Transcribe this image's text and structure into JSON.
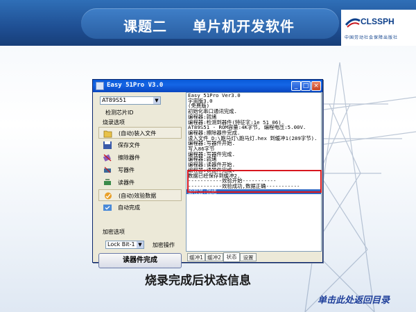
{
  "slide": {
    "title_part1": "课题二",
    "title_part2": "单片机开发软件",
    "logo_text": "CLSSPH",
    "logo_subtext": "中国劳动社会保障出版社",
    "caption": "烧录完成后状态信息",
    "back_link": "单击此处返回目录"
  },
  "window": {
    "title": "Easy 51Pro V3.0",
    "chip_value": "AT89S51",
    "detect_label": "检测芯片ID",
    "burn_options_label": "烧录选项",
    "menu": [
      {
        "label": "(自动)装入文件",
        "icon": "folder-open-icon"
      },
      {
        "label": "保存文件",
        "icon": "save-disk-icon"
      },
      {
        "label": "擦除器件",
        "icon": "erase-icon"
      },
      {
        "label": "写器件",
        "icon": "write-chip-icon"
      },
      {
        "label": "读器件",
        "icon": "read-chip-icon"
      },
      {
        "label": "(自动)效验数据",
        "icon": "verify-icon"
      },
      {
        "label": "自动完成",
        "icon": "auto-complete-icon"
      }
    ],
    "encrypt_label": "加密选项",
    "lock_value": "Lock Bit-1",
    "encrypt_action": "加密操作",
    "read_button": "读器件完成",
    "log_lines": [
      "Easy 51Pro Ver3.0",
      "宇宙版3.0",
      "(免费版)",
      "初始化串口通讯完成.",
      "编程器:就绪",
      "编程器:检测到器件(特征字:1e 51 06).",
      "AT89S51 - ROM容量:4K字节, 编程电压:5.00V.",
      "编程器:擦除器件完成.",
      "读入文件 D:\\跑马灯\\跑马灯.hex 到缓冲1(289字节).",
      "编程器:写器件开始.",
      "写入86字节",
      "编程器:写器件完成.",
      "编程器:就绪",
      "编程器:读器件开始.",
      "编程器:读器件完成.",
      "数据已经保存到缓冲2.",
      "-----------效验开始-----------",
      "-----------效验成功,数据正确-----------",
      "编程器:就绪"
    ],
    "tabs": [
      "缓冲1",
      "缓冲2",
      "状态",
      "设置"
    ],
    "active_tab": "状态"
  }
}
